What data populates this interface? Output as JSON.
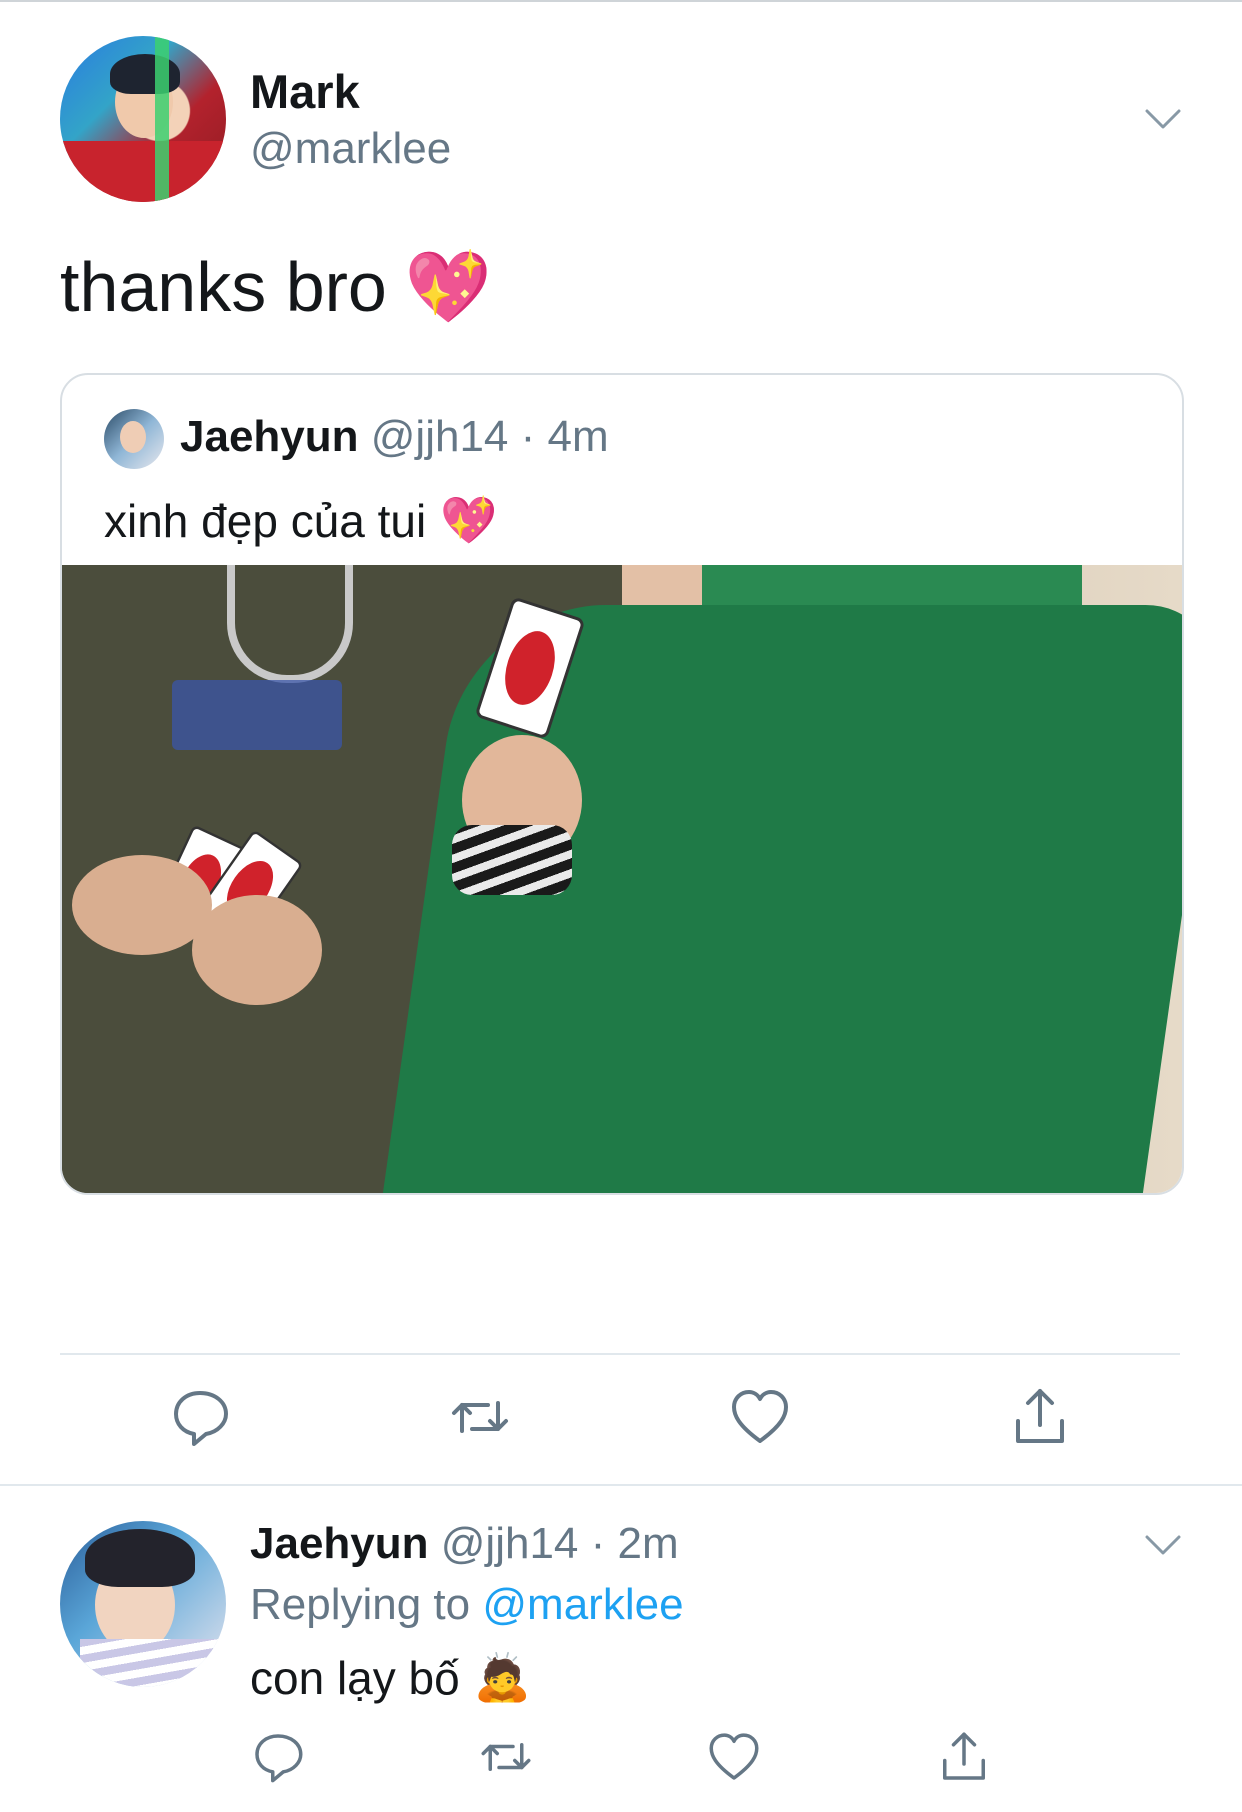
{
  "tweet": {
    "author_name": "Mark",
    "author_handle": "@marklee",
    "text": "thanks bro",
    "emoji": "💖",
    "quote": {
      "author_name": "Jaehyun",
      "author_handle": "@jjh14",
      "separator": "·",
      "time": "4m",
      "text": "xinh đẹp của tui",
      "emoji": "💖"
    }
  },
  "reply": {
    "author_name": "Jaehyun",
    "author_handle": "@jjh14",
    "separator": "·",
    "time": "2m",
    "replying_prefix": "Replying to",
    "replying_to": "@marklee",
    "text": "con lạy bố",
    "emoji": "🙇"
  },
  "icons": {
    "reply": "reply-icon",
    "retweet": "retweet-icon",
    "like": "heart-icon",
    "share": "share-icon",
    "more": "chevron-down-icon"
  },
  "colors": {
    "text": "#14171a",
    "secondary": "#657786",
    "link": "#1da1f2",
    "border": "#e1e8ed"
  }
}
